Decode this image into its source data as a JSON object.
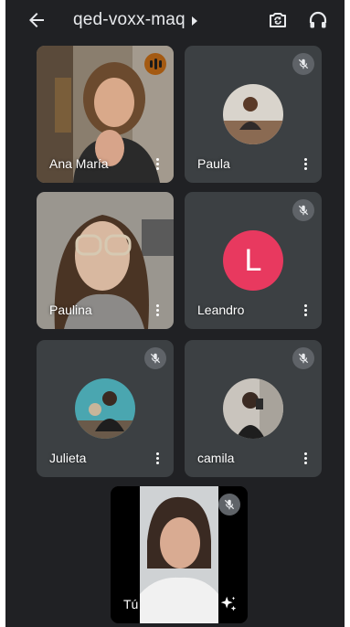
{
  "header": {
    "title": "qed-voxx-maq",
    "back_icon": "arrow-back-icon",
    "switch_camera_icon": "switch-camera-icon",
    "audio_icon": "headphones-icon"
  },
  "participants": [
    {
      "name": "Ana María",
      "status": "speaking"
    },
    {
      "name": "Paula",
      "status": "muted"
    },
    {
      "name": "Paulina",
      "status": "video"
    },
    {
      "name": "Leandro",
      "status": "muted",
      "initial": "L"
    },
    {
      "name": "Julieta",
      "status": "muted"
    },
    {
      "name": "camila",
      "status": "muted"
    }
  ],
  "self": {
    "name": "Tú",
    "status": "muted",
    "effects_icon": "sparkle-effects-icon"
  },
  "colors": {
    "background": "#202124",
    "tile": "#3c4043",
    "leandro_avatar": "#e8395f",
    "speaking_badge": "#a45a12"
  }
}
